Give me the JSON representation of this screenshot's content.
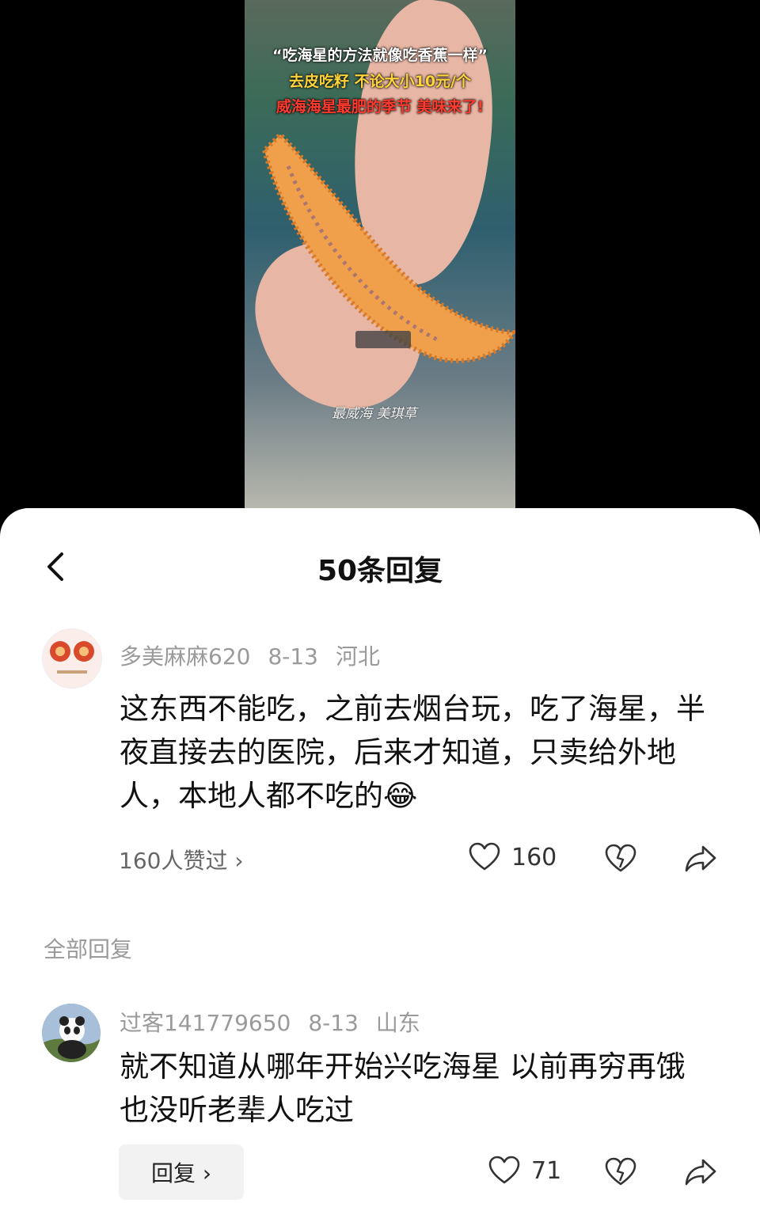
{
  "video": {
    "caption_line1": "“吃海星的方法就像吃香蕉一样”",
    "caption_line2": "去皮吃籽 不论大小10元/个",
    "caption_line3": "威海海星最肥的季节 美味来了!",
    "watermark": "最威海 美琪草"
  },
  "sheet": {
    "title": "50条回复"
  },
  "main_comment": {
    "username": "多美麻麻620",
    "date": "8-13",
    "location": "河北",
    "text": "这东西不能吃，之前去烟台玩，吃了海星，半夜直接去的医院，后来才知道，只卖给外地人，本地人都不吃的",
    "emoji": "😂",
    "likes_link": "160人赞过 ›",
    "like_count": "160"
  },
  "section": {
    "label": "全部回复"
  },
  "replies": [
    {
      "username": "过客141779650",
      "date": "8-13",
      "location": "山东",
      "text": "就不知道从哪年开始兴吃海星 以前再穷再饿也没听老辈人吃过",
      "reply_button": "回复 ›",
      "like_count": "71"
    }
  ],
  "colors": {
    "accent_text": "#111111",
    "muted_text": "#9a9a9a",
    "caption_yellow": "#ffd43b",
    "caption_red": "#ff3b2f"
  },
  "icons": [
    "back-arrow-icon",
    "heart-icon",
    "dislike-icon",
    "share-icon"
  ]
}
